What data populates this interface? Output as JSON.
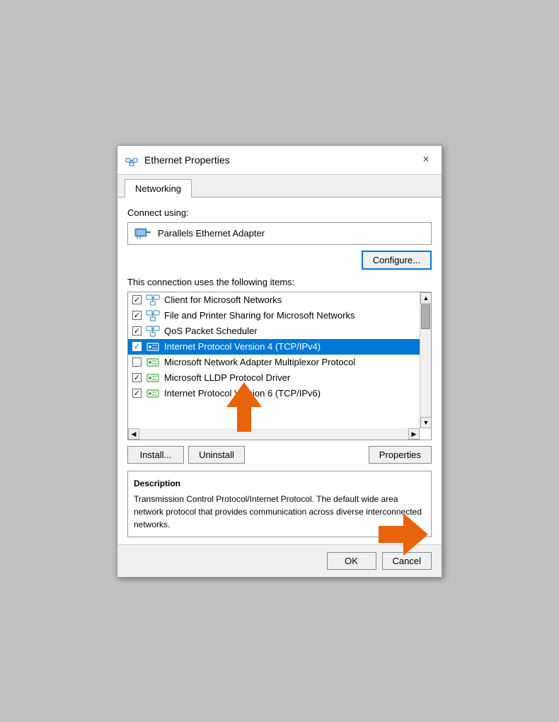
{
  "dialog": {
    "title": "Ethernet Properties",
    "close_label": "×",
    "tab_label": "Networking",
    "connect_using_label": "Connect using:",
    "adapter_name": "Parallels Ethernet Adapter",
    "configure_label": "Configure...",
    "items_label": "This connection uses the following items:",
    "list_items": [
      {
        "id": 1,
        "checked": true,
        "label": "Client for Microsoft Networks",
        "icon": "network",
        "selected": false
      },
      {
        "id": 2,
        "checked": true,
        "label": "File and Printer Sharing for Microsoft Networks",
        "icon": "network",
        "selected": false
      },
      {
        "id": 3,
        "checked": true,
        "label": "QoS Packet Scheduler",
        "icon": "network",
        "selected": false
      },
      {
        "id": 4,
        "checked": true,
        "label": "Internet Protocol Version 4 (TCP/IPv4)",
        "icon": "protocol",
        "selected": true
      },
      {
        "id": 5,
        "checked": false,
        "label": "Microsoft Network Adapter Multiplexor Protocol",
        "icon": "protocol",
        "selected": false
      },
      {
        "id": 6,
        "checked": true,
        "label": "Microsoft LLDP Protocol Driver",
        "icon": "protocol",
        "selected": false
      },
      {
        "id": 7,
        "checked": true,
        "label": "Internet Protocol Version 6 (TCP/IPv6)",
        "icon": "protocol",
        "selected": false
      }
    ],
    "install_label": "Install...",
    "uninstall_label": "Uninstall",
    "properties_label": "Properties",
    "description_title": "Description",
    "description_text": "Transmission Control Protocol/Internet Protocol. The default wide area network protocol that provides communication across diverse interconnected networks.",
    "ok_label": "OK",
    "cancel_label": "Cancel"
  }
}
